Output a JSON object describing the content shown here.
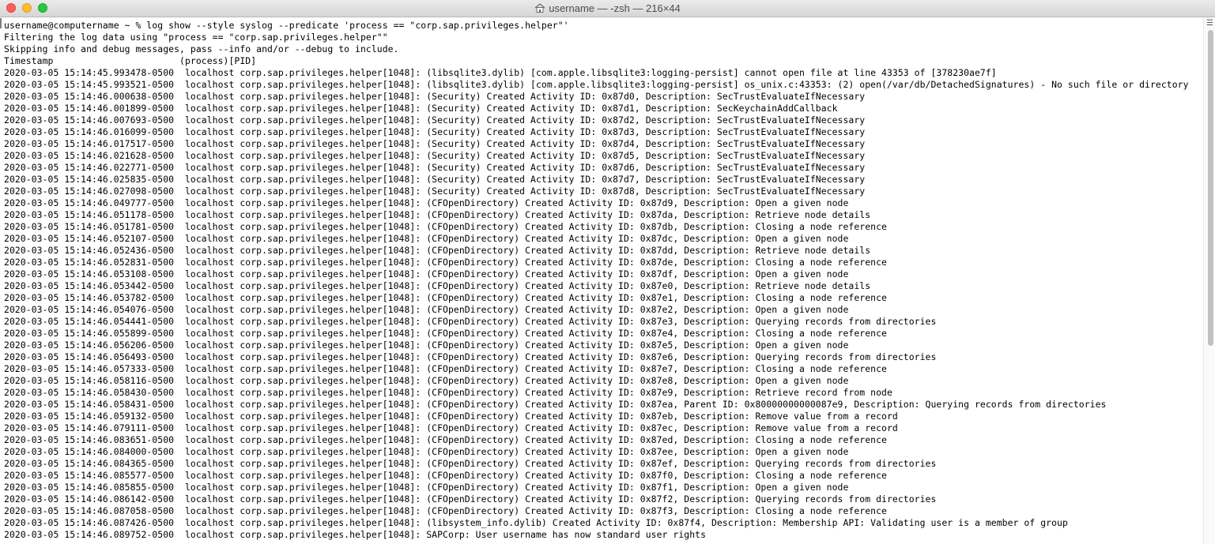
{
  "window": {
    "title": "username — -zsh — 216×44",
    "title_icon": "home-icon"
  },
  "terminal": {
    "lines": [
      "username@computername ~ % log show --style syslog --predicate 'process == \"corp.sap.privileges.helper\"'",
      "Filtering the log data using \"process == \"corp.sap.privileges.helper\"\"",
      "Skipping info and debug messages, pass --info and/or --debug to include.",
      "Timestamp                       (process)[PID]",
      "2020-03-05 15:14:45.993478-0500  localhost corp.sap.privileges.helper[1048]: (libsqlite3.dylib) [com.apple.libsqlite3:logging-persist] cannot open file at line 43353 of [378230ae7f]",
      "2020-03-05 15:14:45.993521-0500  localhost corp.sap.privileges.helper[1048]: (libsqlite3.dylib) [com.apple.libsqlite3:logging-persist] os_unix.c:43353: (2) open(/var/db/DetachedSignatures) - No such file or directory",
      "2020-03-05 15:14:46.000638-0500  localhost corp.sap.privileges.helper[1048]: (Security) Created Activity ID: 0x87d0, Description: SecTrustEvaluateIfNecessary",
      "2020-03-05 15:14:46.001899-0500  localhost corp.sap.privileges.helper[1048]: (Security) Created Activity ID: 0x87d1, Description: SecKeychainAddCallback",
      "2020-03-05 15:14:46.007693-0500  localhost corp.sap.privileges.helper[1048]: (Security) Created Activity ID: 0x87d2, Description: SecTrustEvaluateIfNecessary",
      "2020-03-05 15:14:46.016099-0500  localhost corp.sap.privileges.helper[1048]: (Security) Created Activity ID: 0x87d3, Description: SecTrustEvaluateIfNecessary",
      "2020-03-05 15:14:46.017517-0500  localhost corp.sap.privileges.helper[1048]: (Security) Created Activity ID: 0x87d4, Description: SecTrustEvaluateIfNecessary",
      "2020-03-05 15:14:46.021628-0500  localhost corp.sap.privileges.helper[1048]: (Security) Created Activity ID: 0x87d5, Description: SecTrustEvaluateIfNecessary",
      "2020-03-05 15:14:46.022771-0500  localhost corp.sap.privileges.helper[1048]: (Security) Created Activity ID: 0x87d6, Description: SecTrustEvaluateIfNecessary",
      "2020-03-05 15:14:46.025835-0500  localhost corp.sap.privileges.helper[1048]: (Security) Created Activity ID: 0x87d7, Description: SecTrustEvaluateIfNecessary",
      "2020-03-05 15:14:46.027098-0500  localhost corp.sap.privileges.helper[1048]: (Security) Created Activity ID: 0x87d8, Description: SecTrustEvaluateIfNecessary",
      "2020-03-05 15:14:46.049777-0500  localhost corp.sap.privileges.helper[1048]: (CFOpenDirectory) Created Activity ID: 0x87d9, Description: Open a given node",
      "2020-03-05 15:14:46.051178-0500  localhost corp.sap.privileges.helper[1048]: (CFOpenDirectory) Created Activity ID: 0x87da, Description: Retrieve node details",
      "2020-03-05 15:14:46.051781-0500  localhost corp.sap.privileges.helper[1048]: (CFOpenDirectory) Created Activity ID: 0x87db, Description: Closing a node reference",
      "2020-03-05 15:14:46.052107-0500  localhost corp.sap.privileges.helper[1048]: (CFOpenDirectory) Created Activity ID: 0x87dc, Description: Open a given node",
      "2020-03-05 15:14:46.052436-0500  localhost corp.sap.privileges.helper[1048]: (CFOpenDirectory) Created Activity ID: 0x87dd, Description: Retrieve node details",
      "2020-03-05 15:14:46.052831-0500  localhost corp.sap.privileges.helper[1048]: (CFOpenDirectory) Created Activity ID: 0x87de, Description: Closing a node reference",
      "2020-03-05 15:14:46.053108-0500  localhost corp.sap.privileges.helper[1048]: (CFOpenDirectory) Created Activity ID: 0x87df, Description: Open a given node",
      "2020-03-05 15:14:46.053442-0500  localhost corp.sap.privileges.helper[1048]: (CFOpenDirectory) Created Activity ID: 0x87e0, Description: Retrieve node details",
      "2020-03-05 15:14:46.053782-0500  localhost corp.sap.privileges.helper[1048]: (CFOpenDirectory) Created Activity ID: 0x87e1, Description: Closing a node reference",
      "2020-03-05 15:14:46.054076-0500  localhost corp.sap.privileges.helper[1048]: (CFOpenDirectory) Created Activity ID: 0x87e2, Description: Open a given node",
      "2020-03-05 15:14:46.054441-0500  localhost corp.sap.privileges.helper[1048]: (CFOpenDirectory) Created Activity ID: 0x87e3, Description: Querying records from directories",
      "2020-03-05 15:14:46.055899-0500  localhost corp.sap.privileges.helper[1048]: (CFOpenDirectory) Created Activity ID: 0x87e4, Description: Closing a node reference",
      "2020-03-05 15:14:46.056206-0500  localhost corp.sap.privileges.helper[1048]: (CFOpenDirectory) Created Activity ID: 0x87e5, Description: Open a given node",
      "2020-03-05 15:14:46.056493-0500  localhost corp.sap.privileges.helper[1048]: (CFOpenDirectory) Created Activity ID: 0x87e6, Description: Querying records from directories",
      "2020-03-05 15:14:46.057333-0500  localhost corp.sap.privileges.helper[1048]: (CFOpenDirectory) Created Activity ID: 0x87e7, Description: Closing a node reference",
      "2020-03-05 15:14:46.058116-0500  localhost corp.sap.privileges.helper[1048]: (CFOpenDirectory) Created Activity ID: 0x87e8, Description: Open a given node",
      "2020-03-05 15:14:46.058430-0500  localhost corp.sap.privileges.helper[1048]: (CFOpenDirectory) Created Activity ID: 0x87e9, Description: Retrieve record from node",
      "2020-03-05 15:14:46.058431-0500  localhost corp.sap.privileges.helper[1048]: (CFOpenDirectory) Created Activity ID: 0x87ea, Parent ID: 0x80000000000087e9, Description: Querying records from directories",
      "2020-03-05 15:14:46.059132-0500  localhost corp.sap.privileges.helper[1048]: (CFOpenDirectory) Created Activity ID: 0x87eb, Description: Remove value from a record",
      "2020-03-05 15:14:46.079111-0500  localhost corp.sap.privileges.helper[1048]: (CFOpenDirectory) Created Activity ID: 0x87ec, Description: Remove value from a record",
      "2020-03-05 15:14:46.083651-0500  localhost corp.sap.privileges.helper[1048]: (CFOpenDirectory) Created Activity ID: 0x87ed, Description: Closing a node reference",
      "2020-03-05 15:14:46.084000-0500  localhost corp.sap.privileges.helper[1048]: (CFOpenDirectory) Created Activity ID: 0x87ee, Description: Open a given node",
      "2020-03-05 15:14:46.084365-0500  localhost corp.sap.privileges.helper[1048]: (CFOpenDirectory) Created Activity ID: 0x87ef, Description: Querying records from directories",
      "2020-03-05 15:14:46.085577-0500  localhost corp.sap.privileges.helper[1048]: (CFOpenDirectory) Created Activity ID: 0x87f0, Description: Closing a node reference",
      "2020-03-05 15:14:46.085855-0500  localhost corp.sap.privileges.helper[1048]: (CFOpenDirectory) Created Activity ID: 0x87f1, Description: Open a given node",
      "2020-03-05 15:14:46.086142-0500  localhost corp.sap.privileges.helper[1048]: (CFOpenDirectory) Created Activity ID: 0x87f2, Description: Querying records from directories",
      "2020-03-05 15:14:46.087058-0500  localhost corp.sap.privileges.helper[1048]: (CFOpenDirectory) Created Activity ID: 0x87f3, Description: Closing a node reference",
      "2020-03-05 15:14:46.087426-0500  localhost corp.sap.privileges.helper[1048]: (libsystem_info.dylib) Created Activity ID: 0x87f4, Description: Membership API: Validating user is a member of group",
      "2020-03-05 15:14:46.089752-0500  localhost corp.sap.privileges.helper[1048]: SAPCorp: User username has now standard user rights"
    ]
  },
  "colors": {
    "text": "#000000",
    "background": "#ffffff",
    "titlebar": "#e3e3e3",
    "close": "#fd5f57",
    "minimize": "#febc2e",
    "zoom": "#28c840"
  }
}
